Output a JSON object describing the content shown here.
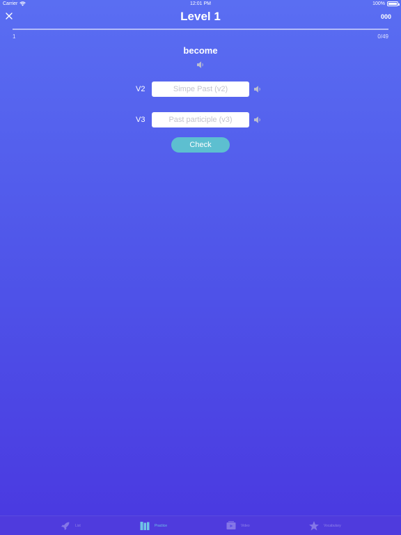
{
  "status_bar": {
    "carrier": "Carrier",
    "time": "12:01 PM",
    "battery": "100%"
  },
  "header": {
    "title": "Level 1",
    "score": "000"
  },
  "progress": {
    "start": "1",
    "count": "0/49",
    "value": 0
  },
  "quiz": {
    "word": "become",
    "v2_label": "V2",
    "v2_placeholder": "Simpe Past (v2)",
    "v3_label": "V3",
    "v3_placeholder": "Past participle (v3)",
    "check_label": "Check"
  },
  "tabs": [
    {
      "label": "List",
      "icon": "rocket-icon",
      "active": false
    },
    {
      "label": "Practice",
      "icon": "books-icon",
      "active": true
    },
    {
      "label": "Video",
      "icon": "video-icon",
      "active": false
    },
    {
      "label": "Vocabulary",
      "icon": "star-icon",
      "active": false
    }
  ],
  "colors": {
    "accent": "#5dbfd0",
    "active_tab": "#6fc4e6",
    "background_top": "#5a6ef2",
    "background_bottom": "#4a38e0"
  }
}
